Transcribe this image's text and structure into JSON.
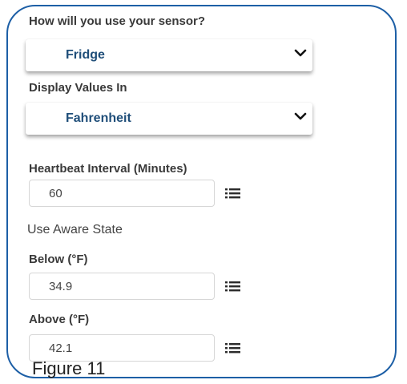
{
  "form": {
    "usage": {
      "label": "How will you use your sensor?",
      "selected": "Fridge"
    },
    "display": {
      "label": "Display Values In",
      "selected": "Fahrenheit"
    },
    "heartbeat": {
      "label": "Heartbeat Interval (Minutes)",
      "value": "60"
    },
    "aware_state_label": "Use Aware State",
    "below": {
      "label": "Below (°F)",
      "value": "34.9"
    },
    "above": {
      "label": "Above (°F)",
      "value": "42.1"
    }
  },
  "caption": "Figure 11",
  "colors": {
    "frame_border": "#1d5fa6",
    "select_text": "#1f4e79",
    "label_text": "#3a3a3a"
  },
  "icons": {
    "dropdown": "chevron-down-icon",
    "options": "list-icon"
  }
}
